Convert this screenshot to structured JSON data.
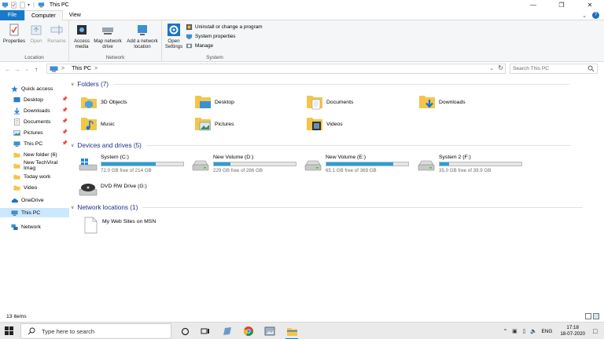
{
  "window": {
    "title": "This PC"
  },
  "tabs": [
    "File",
    "Computer",
    "View"
  ],
  "ribbon": {
    "location": {
      "label": "Location",
      "buttons": [
        "Properties",
        "Open",
        "Rename"
      ]
    },
    "network": {
      "label": "Network",
      "access_media": "Access media",
      "map_drive": "Map network drive",
      "add_location": "Add a network location"
    },
    "system": {
      "label": "System",
      "open_settings": "Open Settings",
      "uninstall": "Uninstall or change a program",
      "system_properties": "System properties",
      "manage": "Manage"
    }
  },
  "address": {
    "path": "This PC",
    "separator": ">",
    "search_placeholder": "Search This PC"
  },
  "nav": {
    "quick_access": "Quick access",
    "items": [
      {
        "label": "Desktop",
        "pinned": true
      },
      {
        "label": "Downloads",
        "pinned": true
      },
      {
        "label": "Documents",
        "pinned": true
      },
      {
        "label": "Pictures",
        "pinned": true
      },
      {
        "label": "This PC",
        "pinned": true
      },
      {
        "label": "New folder (6)",
        "pinned": false
      },
      {
        "label": "New TechViral Imag",
        "pinned": false
      },
      {
        "label": "Today work",
        "pinned": false
      },
      {
        "label": "Video",
        "pinned": false
      }
    ],
    "onedrive": "OneDrive",
    "this_pc": "This PC",
    "network": "Network"
  },
  "content": {
    "folders_header": "Folders (7)",
    "folders": [
      "3D Objects",
      "Desktop",
      "Documents",
      "Downloads",
      "Music",
      "Pictures",
      "Videos"
    ],
    "drives_header": "Devices and drives (5)",
    "drives": [
      {
        "name": "System (C:)",
        "free": "72.0 GB free of 214 GB",
        "used_fraction": 0.66
      },
      {
        "name": "New Volume (D:)",
        "free": "229 GB free of 286 GB",
        "used_fraction": 0.2
      },
      {
        "name": "New Volume (E:)",
        "free": "65.1 GB free of 369 GB",
        "used_fraction": 0.82
      },
      {
        "name": "System 2 (F:)",
        "free": "35.0 GB free of 39.9 GB",
        "used_fraction": 0.12
      }
    ],
    "dvd": "DVD RW Drive (G:)",
    "network_header": "Network locations (1)",
    "network_items": [
      "My Web Sites on MSN"
    ]
  },
  "status": {
    "count": "13 items"
  },
  "taskbar": {
    "search_text": "Type here to search",
    "language": "ENG",
    "time": "17:18",
    "date": "18-07-2020"
  },
  "colors": {
    "accent": "#1979ca",
    "header_text": "#1e3287",
    "drive_fill": "#26a0da",
    "selected": "#cce8ff",
    "folder": "#f3c54a"
  }
}
